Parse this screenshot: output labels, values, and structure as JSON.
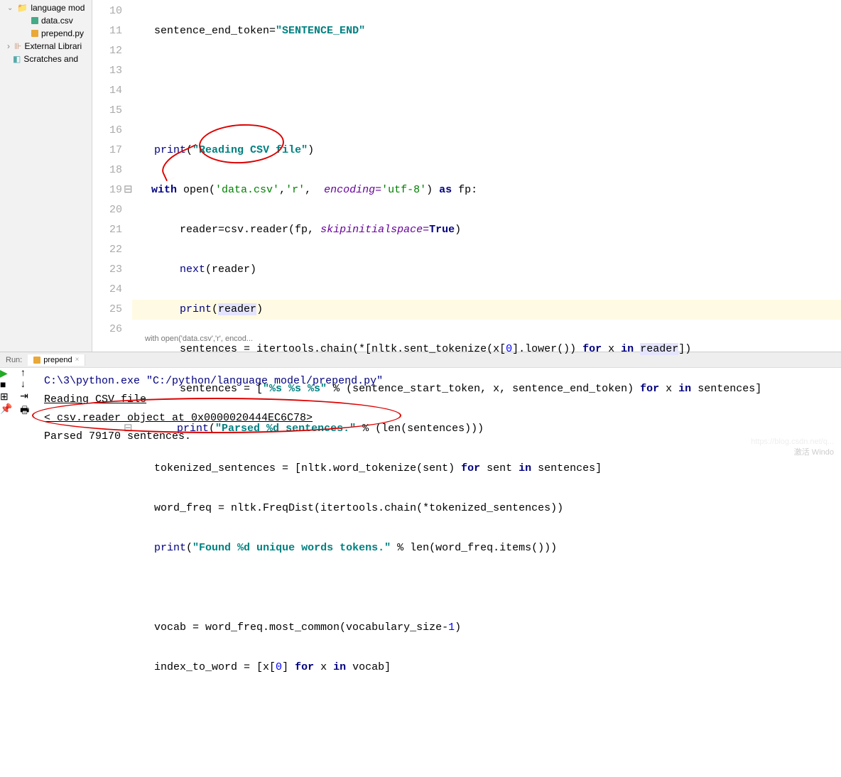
{
  "sidebar": {
    "folder": "language mod",
    "files": [
      "data.csv",
      "prepend.py"
    ],
    "external": "External Librari",
    "scratches": "Scratches and"
  },
  "gutter": [
    "10",
    "11",
    "12",
    "13",
    "14",
    "15",
    "16",
    "17",
    "18",
    "19",
    "20",
    "21",
    "22",
    "23",
    "24",
    "25",
    "26"
  ],
  "code": {
    "l10": {
      "a": "sentence_end_token=",
      "b": "\"SENTENCE_END\""
    },
    "l13": {
      "a": "print",
      "b": "(",
      "c": "\"Reading CSV file\"",
      "d": ")"
    },
    "l14": {
      "a": "with",
      "b": " open(",
      "c": "'data.csv'",
      "d": ",",
      "e": "'r'",
      "f": ",  ",
      "g": "encoding=",
      "h": "'utf-8'",
      "i": ") ",
      "j": "as",
      "k": " fp:"
    },
    "l15": {
      "a": "reader=csv.reader(fp,",
      "b": "skipinitialspace=",
      "c": "True",
      "d": ")"
    },
    "l16": {
      "a": "next",
      "b": "(reader)"
    },
    "l17": {
      "a": "print",
      "b": "(",
      "c": "reader",
      "d": ")"
    },
    "l18": {
      "a": "sentences = itertools.chain(*[nltk.sent_tokenize(x[",
      "b": "0",
      "c": "].lower()) ",
      "d": "for",
      "e": " x ",
      "f": "in",
      "g": " ",
      "h": "reader",
      "i": "])"
    },
    "l19": {
      "a": "sentences = [",
      "b": "\"%s %s %s\"",
      "c": " % (sentence_start_token, x, sentence_end_token) ",
      "d": "for",
      "e": " x ",
      "f": "in",
      "g": " sentences]"
    },
    "l20": {
      "a": "print",
      "b": "(",
      "c": "\"Parsed %d sentences.\"",
      "d": " % (len(sentences)))"
    },
    "l21": {
      "a": "tokenized_sentences = [nltk.word_tokenize(sent) ",
      "b": "for",
      "c": " sent ",
      "d": "in",
      "e": " sentences]"
    },
    "l22": {
      "a": "word_freq = nltk.FreqDist(itertools.chain(*tokenized_sentences))"
    },
    "l23": {
      "a": "print",
      "b": "(",
      "c": "\"Found %d unique words tokens.\"",
      "d": " % len(word_freq.items()))"
    },
    "l25": {
      "a": "vocab = word_freq.most_common(vocabulary_size-",
      "b": "1",
      "c": ")"
    },
    "l26": {
      "a": "index_to_word = [x[",
      "b": "0",
      "c": "] ",
      "d": "for",
      "e": " x ",
      "f": "in",
      "g": " vocab]"
    }
  },
  "breadcrumb": "with open('data.csv','r', encod...",
  "run": {
    "label": "Run:",
    "tab": "prepend",
    "output": {
      "l1": "C:\\3\\python.exe \"C:/python/language model/prepend.py\"",
      "l2": "Reading CSV file",
      "l3": "<_csv.reader object at 0x0000020444EC6C78>",
      "l4": "Parsed 79170 sentences."
    }
  },
  "watermark": "激活 Windo",
  "watermark2": "https://blog.csdn.net/q..."
}
